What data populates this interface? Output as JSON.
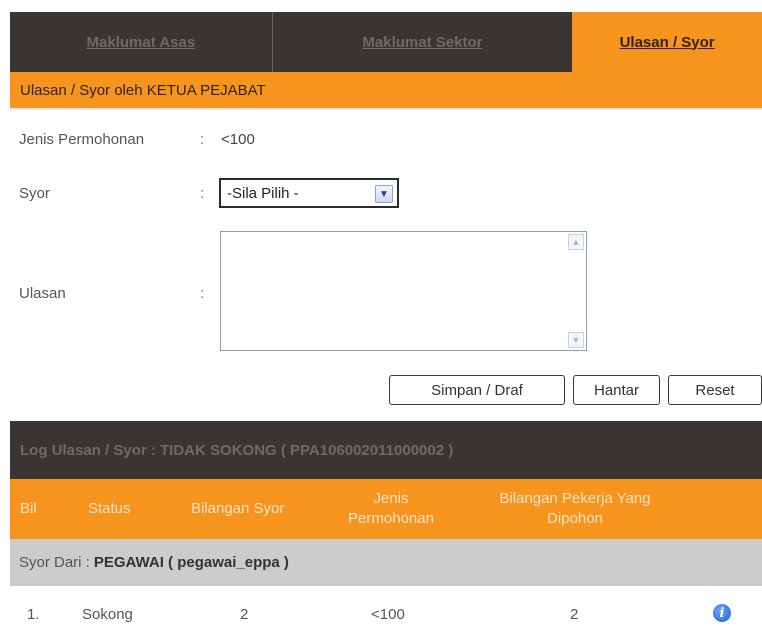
{
  "tabs": [
    {
      "label": "Maklumat Asas"
    },
    {
      "label": "Maklumat Sektor"
    },
    {
      "label": "Ulasan / Syor"
    }
  ],
  "form": {
    "title": "Ulasan / Syor oleh KETUA PEJABAT",
    "jenis_label": "Jenis Permohonan",
    "jenis_value": "<100",
    "syor_label": "Syor",
    "syor_value": "-Sila Pilih -",
    "ulasan_label": "Ulasan",
    "ulasan_value": "",
    "colon": ":",
    "buttons": {
      "save": "Simpan / Draf",
      "send": "Hantar",
      "reset": "Reset"
    }
  },
  "log": {
    "title": "Log Ulasan / Syor : TIDAK SOKONG ( PPA106002011000002 )",
    "headers": [
      "Bil",
      "Status",
      "Bilangan Syor",
      "Jenis Permohonan",
      "Bilangan Pekerja Yang Dipohon"
    ],
    "group_label": "Syor Dari :",
    "group_value": "PEGAWAI ( pegawai_eppa )",
    "rows": [
      {
        "bil": "1.",
        "status": "Sokong",
        "bilangan_syor": "2",
        "jenis": "<100",
        "pekerja": "2"
      }
    ]
  },
  "icons": {
    "info": "info-icon",
    "select_arrow": "chevron-down-icon"
  },
  "colors": {
    "accent": "#f7941d",
    "dark": "#3a3433",
    "group": "#cccccc"
  }
}
